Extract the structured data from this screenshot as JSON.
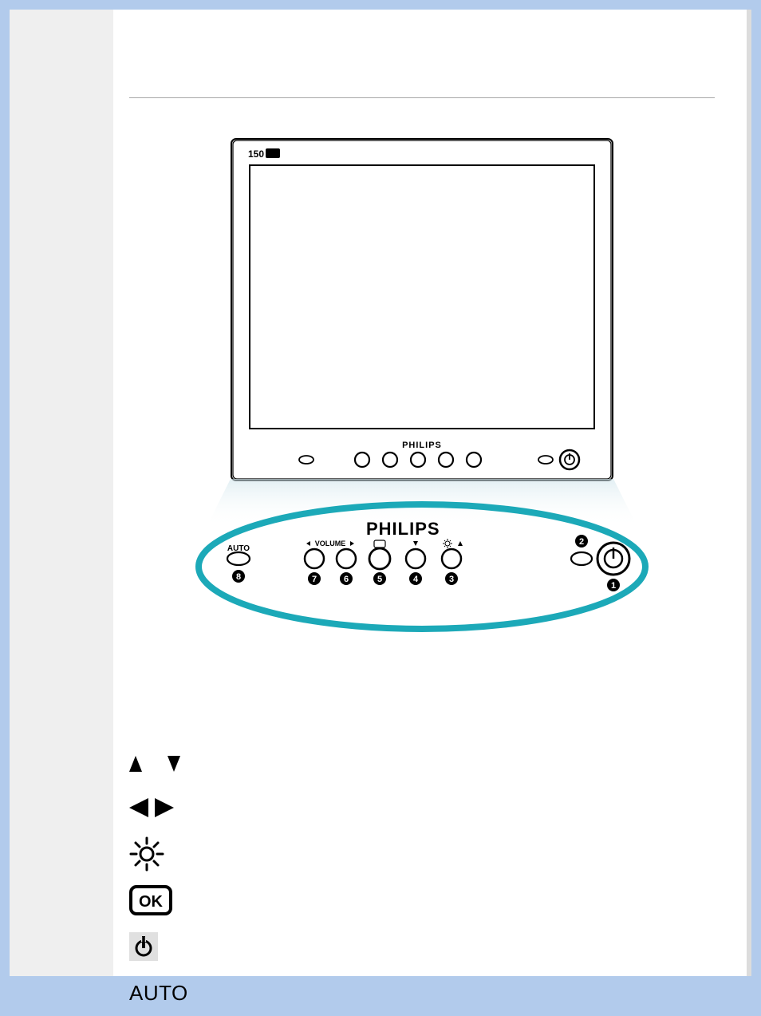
{
  "monitor": {
    "model_badge": "150",
    "brand": "PHILIPS"
  },
  "zoom_panel": {
    "brand": "PHILIPS",
    "auto_label": "AUTO",
    "volume_label": "VOLUME",
    "callouts": [
      "1",
      "2",
      "3",
      "4",
      "5",
      "6",
      "7",
      "8"
    ]
  },
  "legend": {
    "items": [
      {
        "icon": "up-down-arrows"
      },
      {
        "icon": "left-right-arrows"
      },
      {
        "icon": "brightness-icon"
      },
      {
        "icon": "ok-icon",
        "label": "OK"
      },
      {
        "icon": "power-icon"
      },
      {
        "icon": "auto-text",
        "label": "AUTO"
      }
    ]
  }
}
